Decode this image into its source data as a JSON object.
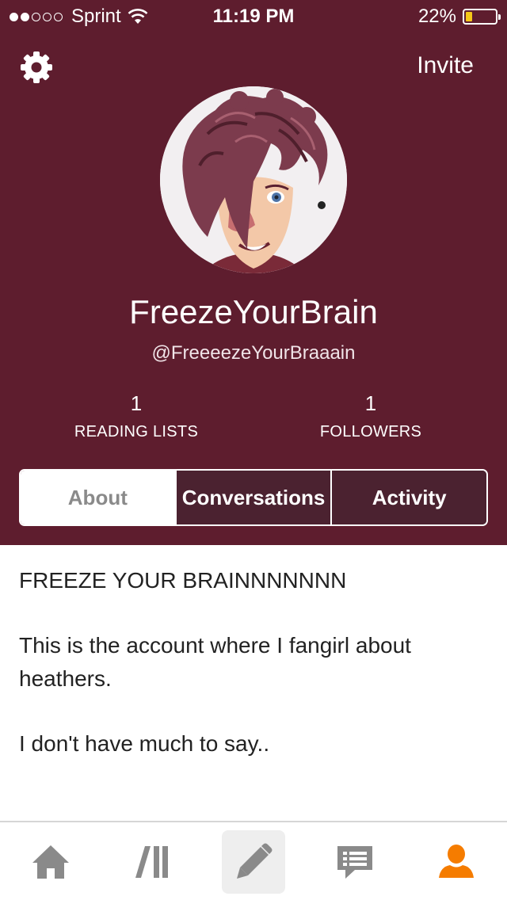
{
  "status_bar": {
    "carrier": "Sprint",
    "signal_bars_filled": 2,
    "signal_bars_total": 5,
    "time": "11:19 PM",
    "battery_text": "22%",
    "battery_level": 0.22,
    "battery_color": "#f6c818"
  },
  "header": {
    "settings_icon": "gear-icon",
    "invite_label": "Invite",
    "background_color": "#5e1d2e"
  },
  "profile": {
    "display_name": "FreezeYourBrain",
    "username": "@FreeeezeYourBraaain",
    "stats": [
      {
        "value": "1",
        "label": "READING LISTS"
      },
      {
        "value": "1",
        "label": "FOLLOWERS"
      }
    ]
  },
  "tabs": [
    {
      "label": "About",
      "active": true
    },
    {
      "label": "Conversations",
      "active": false
    },
    {
      "label": "Activity",
      "active": false
    }
  ],
  "about": {
    "paragraphs": [
      "FREEZE YOUR BRAINNNNNNN",
      "This is the account where I fangirl about heathers.",
      "I don't have much to say.."
    ]
  },
  "tab_bar": {
    "items": [
      {
        "icon": "home-icon"
      },
      {
        "icon": "library-icon"
      },
      {
        "icon": "pencil-icon"
      },
      {
        "icon": "messages-icon"
      },
      {
        "icon": "profile-icon"
      }
    ],
    "accent_color": "#f57c00",
    "icon_color": "#8a8a8a"
  }
}
